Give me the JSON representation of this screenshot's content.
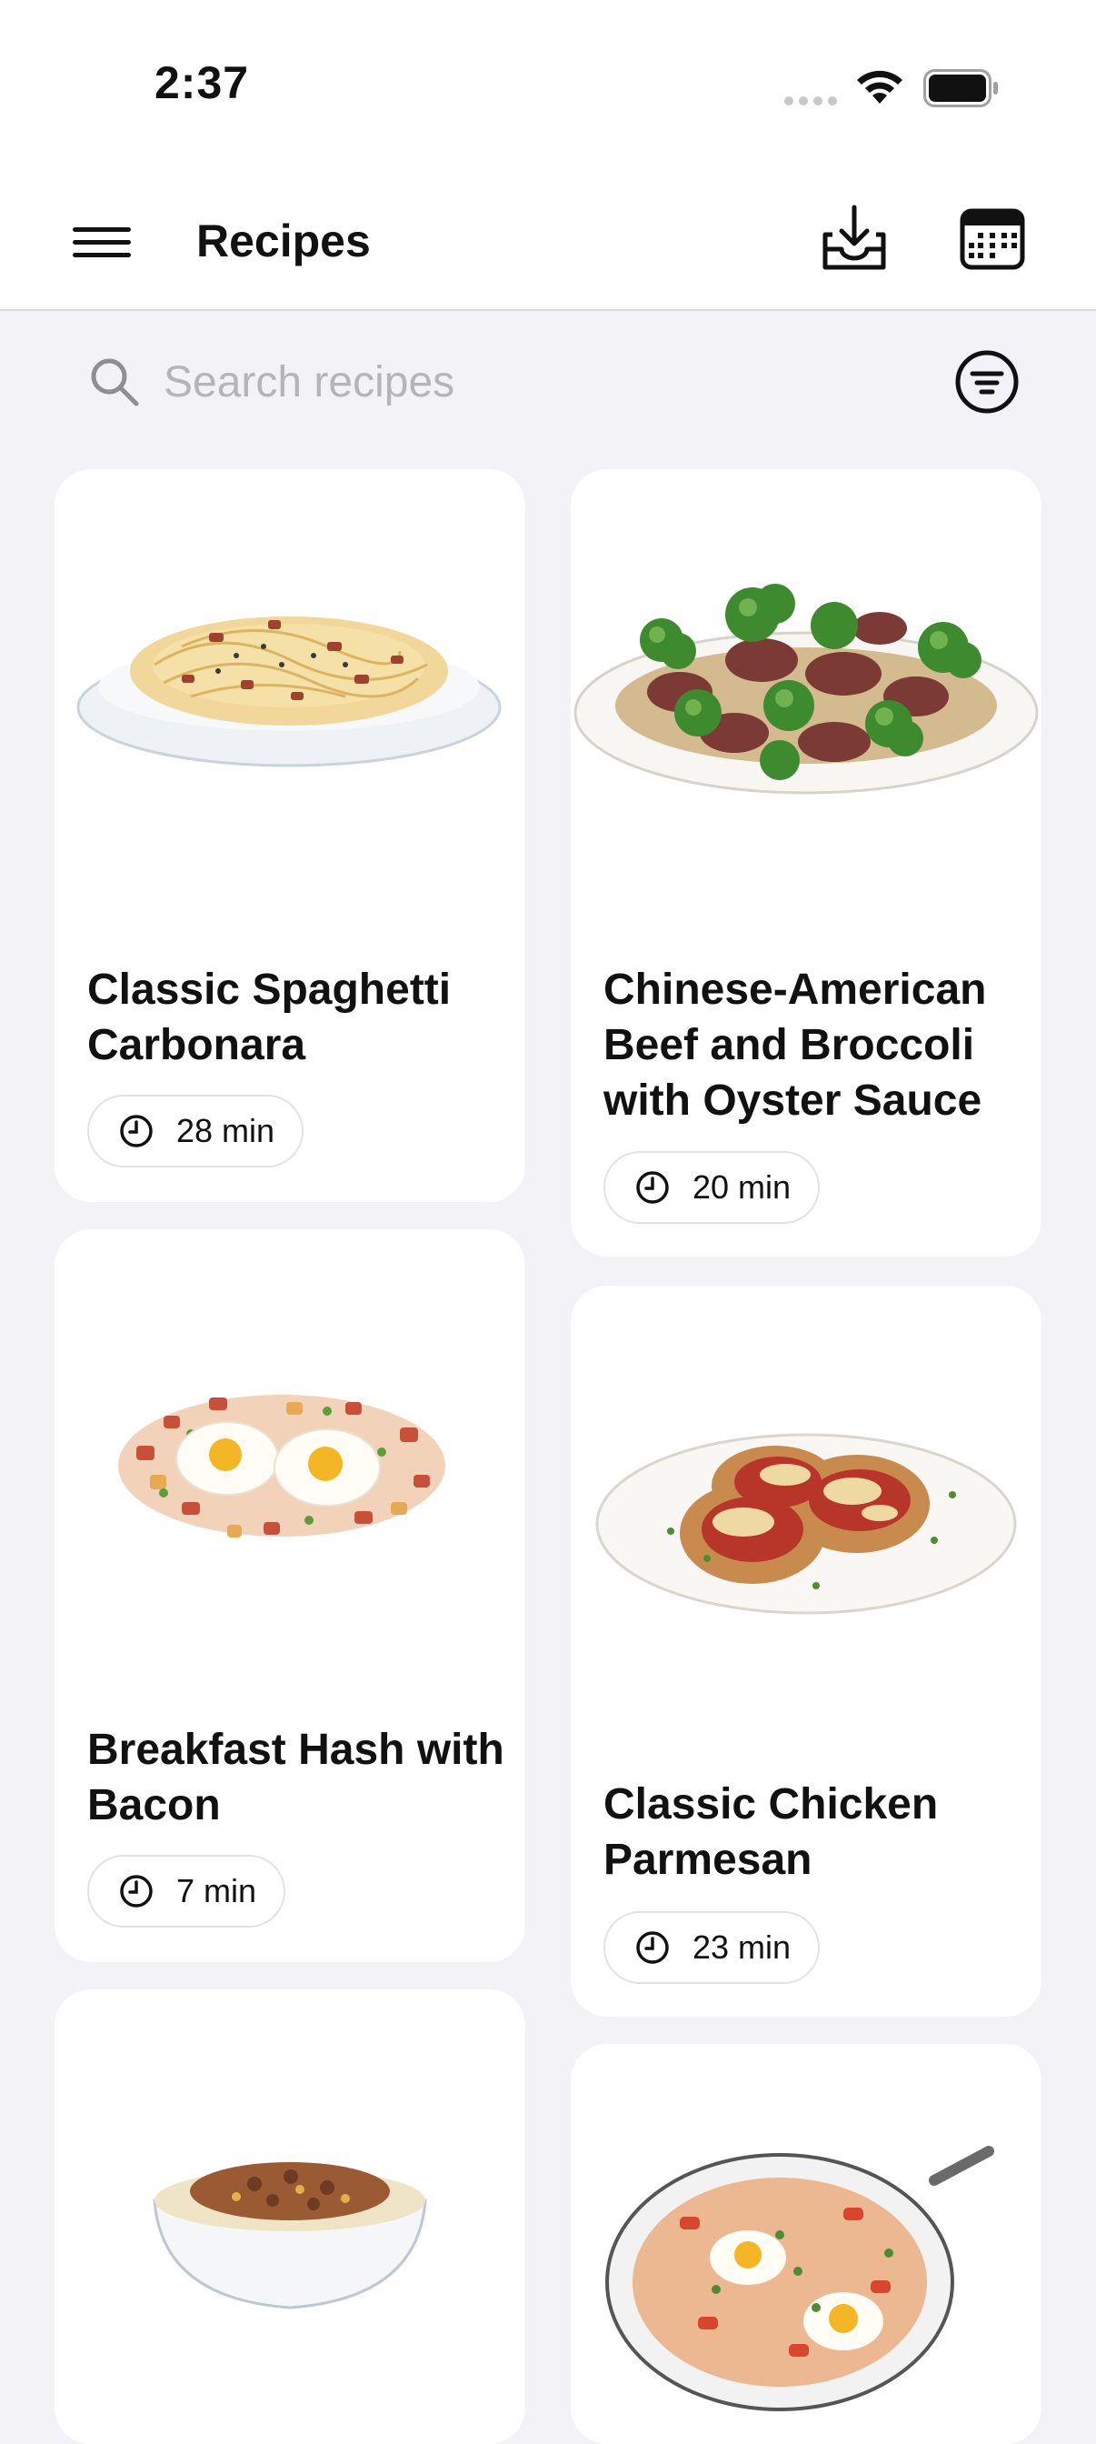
{
  "status_bar": {
    "time": "2:37"
  },
  "header": {
    "title": "Recipes"
  },
  "search": {
    "placeholder": "Search recipes"
  },
  "recipes": [
    {
      "title": "Classic Spaghetti Carbonara",
      "time": "28 min"
    },
    {
      "title": "Chinese-American Beef and Broccoli with Oyster Sauce",
      "time": "20 min"
    },
    {
      "title": "Breakfast Hash with Bacon",
      "time": "7 min"
    },
    {
      "title": "Classic Chicken Parmesan",
      "time": "23 min"
    },
    {
      "title": "",
      "time": ""
    },
    {
      "title": "",
      "time": ""
    }
  ]
}
